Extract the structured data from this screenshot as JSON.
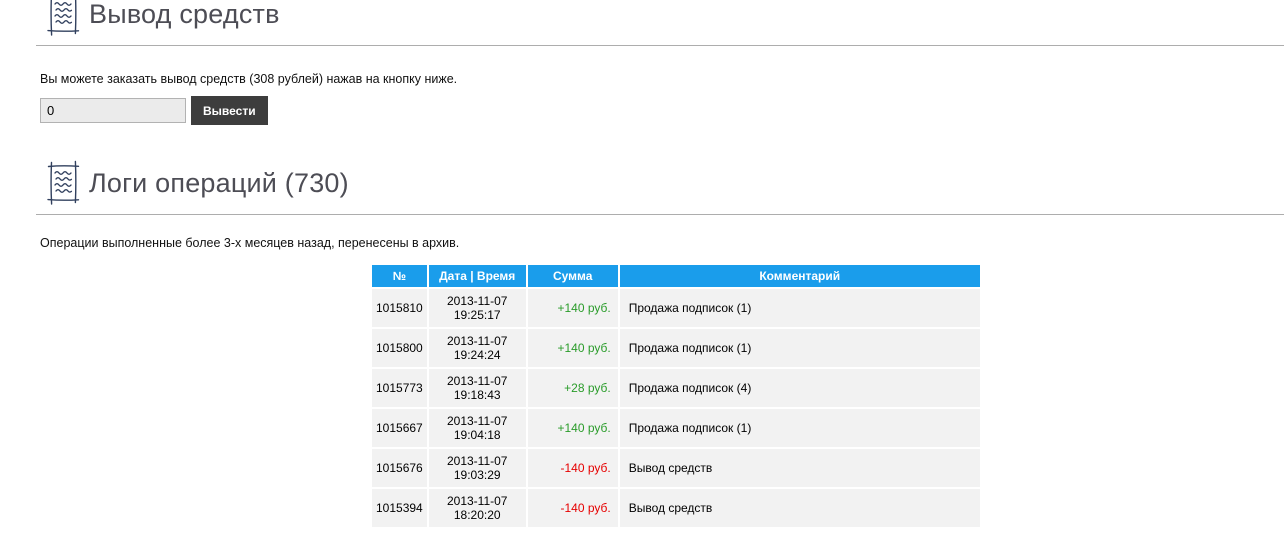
{
  "withdraw_section": {
    "title": "Вывод средств",
    "description": "Вы можете заказать вывод средств (308 рублей) нажав на кнопку ниже.",
    "balance_rub": 308,
    "input_value": "0",
    "button_label": "Вывести"
  },
  "logs_section": {
    "title": "Логи операций (730)",
    "operations_count": 730,
    "description": "Операции выполненные более 3-х месяцев назад, перенесены в архив."
  },
  "table": {
    "headers": [
      "№",
      "Дата | Время",
      "Сумма",
      "Комментарий"
    ],
    "rows": [
      {
        "id": "1015810",
        "date": "2013-11-07",
        "time": "19:25:17",
        "amount": "+140 руб.",
        "sign": "positive",
        "comment": "Продажа подписок (1)"
      },
      {
        "id": "1015800",
        "date": "2013-11-07",
        "time": "19:24:24",
        "amount": "+140 руб.",
        "sign": "positive",
        "comment": "Продажа подписок (1)"
      },
      {
        "id": "1015773",
        "date": "2013-11-07",
        "time": "19:18:43",
        "amount": "+28 руб.",
        "sign": "positive",
        "comment": "Продажа подписок (4)"
      },
      {
        "id": "1015667",
        "date": "2013-11-07",
        "time": "19:04:18",
        "amount": "+140 руб.",
        "sign": "positive",
        "comment": "Продажа подписок (1)"
      },
      {
        "id": "1015676",
        "date": "2013-11-07",
        "time": "19:03:29",
        "amount": "-140 руб.",
        "sign": "negative",
        "comment": "Вывод средств"
      },
      {
        "id": "1015394",
        "date": "2013-11-07",
        "time": "18:20:20",
        "amount": "-140 руб.",
        "sign": "negative",
        "comment": "Вывод средств"
      }
    ]
  },
  "icons": {
    "section_icon": "document-sketch-icon"
  },
  "colors": {
    "header_blue": "#1a9deb",
    "positive_green": "#2a9c2a",
    "negative_red": "#e60000",
    "row_bg": "#f2f2f2",
    "title_gray": "#4d4d55",
    "button_bg": "#3d3d3d"
  }
}
